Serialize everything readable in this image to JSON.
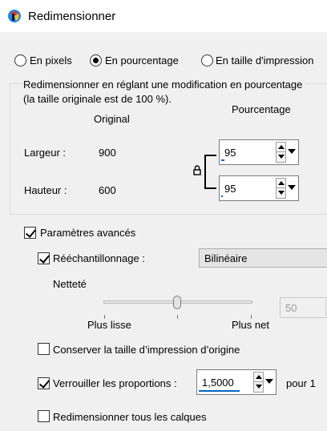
{
  "window": {
    "title": "Redimensionner"
  },
  "mode": {
    "options": [
      {
        "label": "En pixels",
        "checked": false
      },
      {
        "label": "En pourcentage",
        "checked": true
      },
      {
        "label": "En taille d'impression",
        "checked": false
      }
    ]
  },
  "group": {
    "line1": "Redimensionner en réglant une modification en pourcentage",
    "line2": "(la taille originale est de 100 %)."
  },
  "dims": {
    "original_header": "Original",
    "percent_header": "Pourcentage",
    "width_label": "Largeur :",
    "width_original": "900",
    "width_percent": "95",
    "height_label": "Hauteur :",
    "height_original": "600",
    "height_percent": "95"
  },
  "advanced": {
    "label": "Paramètres avancés",
    "checked": true,
    "resample_label": "Rééchantillonnage :",
    "resample_checked": true,
    "resample_value": "Bilinéaire",
    "sharpness_label": "Netteté",
    "slider_min_label": "Plus lisse",
    "slider_max_label": "Plus net",
    "sharpness_value": "50",
    "keep_print_label": "Conserver la taille d’impression d’origine",
    "keep_print_checked": false,
    "lock_ratio_label": "Verrouiller les proportions :",
    "lock_ratio_checked": true,
    "ratio_value": "1,5000",
    "ratio_suffix": "pour 1",
    "all_layers_label": "Redimensionner tous les calques",
    "all_layers_checked": false
  },
  "colors": {
    "accent": "#0067c0"
  }
}
